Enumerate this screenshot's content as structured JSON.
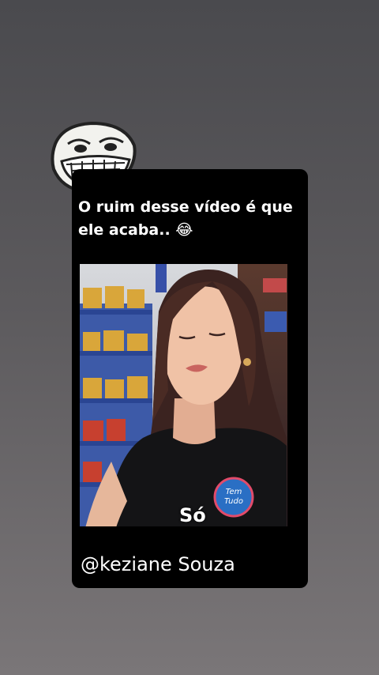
{
  "post": {
    "caption_line1": "O ruim desse vídeo é que",
    "caption_line2": "ele acaba..",
    "caption_emoji": "😂",
    "subtitle": "Só",
    "credit": "@keziane Souza",
    "shirt_logo_line1": "Tem",
    "shirt_logo_line2": "Tudo"
  },
  "icons": {
    "sticker": "troll-face-icon",
    "emoji": "laughing-tears-emoji-icon"
  },
  "colors": {
    "card_bg": "#000000",
    "text": "#ffffff",
    "page_bg_top": "#4a4a4e",
    "page_bg_bottom": "#7a7678"
  }
}
